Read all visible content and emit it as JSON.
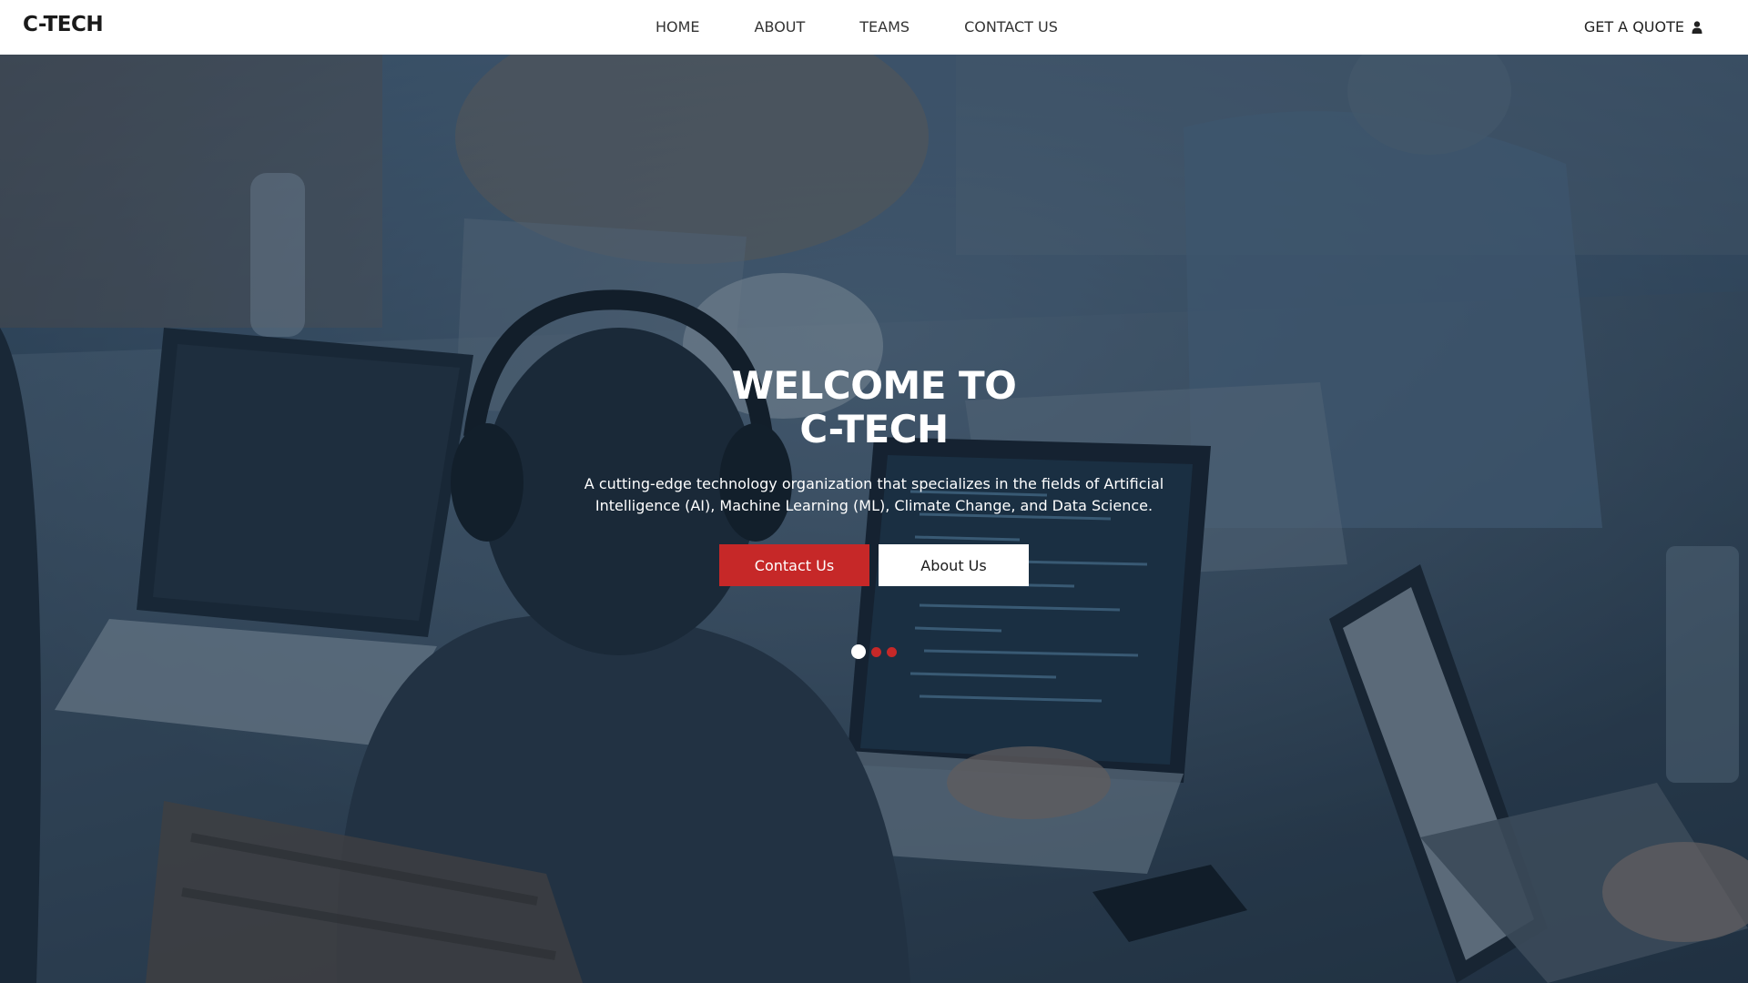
{
  "brand": {
    "name": "C-TECH"
  },
  "nav": {
    "items": [
      {
        "label": "HOME"
      },
      {
        "label": "ABOUT"
      },
      {
        "label": "TEAMS"
      },
      {
        "label": "CONTACT US"
      }
    ],
    "quote_label": "GET A QUOTE"
  },
  "hero": {
    "title_line1": "WELCOME TO",
    "title_line2": "C-TECH",
    "description": "A cutting-edge technology organization that specializes in the fields of Artificial Intelligence (AI), Machine Learning (ML), Climate Change, and Data Science.",
    "primary_button": "Contact Us",
    "secondary_button": "About Us",
    "carousel": {
      "slides": 3,
      "active": 1
    }
  },
  "colors": {
    "accent": "#c62828",
    "nav_bg": "#ffffff",
    "overlay": "#162a3e"
  },
  "icons": {
    "quote_icon": "user-icon"
  }
}
